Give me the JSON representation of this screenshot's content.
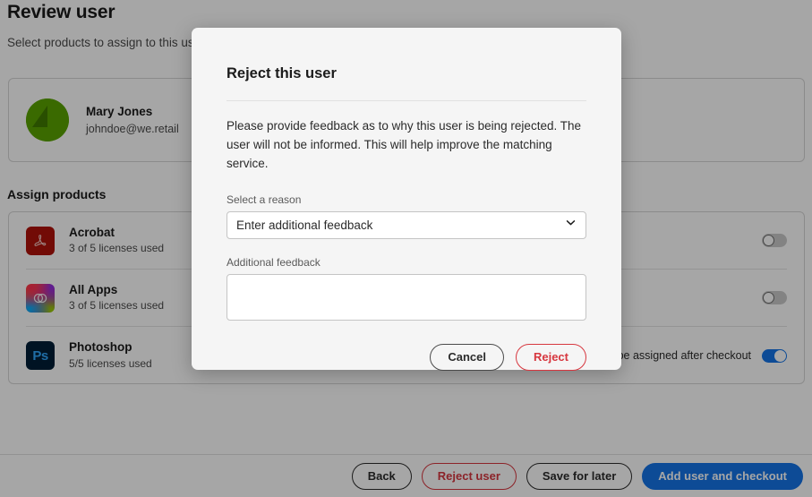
{
  "page": {
    "title": "Review user",
    "subtitle": "Select products to assign to this user",
    "section_title": "Assign products"
  },
  "user": {
    "name": "Mary Jones",
    "email": "johndoe@we.retail",
    "avatar_color": "#5aa300",
    "avatar_accent": "#3f7a00"
  },
  "products": [
    {
      "name": "Acrobat",
      "licenses": "3 of 5 licenses used",
      "icon": "acrobat-icon",
      "glyph": "A",
      "note": "",
      "toggle_on": false
    },
    {
      "name": "All Apps",
      "licenses": "3 of 5 licenses used",
      "icon": "creative-cloud-icon",
      "glyph": "",
      "note": "",
      "toggle_on": false
    },
    {
      "name": "Photoshop",
      "licenses": "5/5 licenses used",
      "icon": "photoshop-icon",
      "glyph": "Ps",
      "note": "ill be assigned after checkout",
      "toggle_on": true
    }
  ],
  "footer": {
    "back": "Back",
    "reject_user": "Reject user",
    "save_for_later": "Save for later",
    "add_user_and_checkout": "Add user and checkout"
  },
  "dialog": {
    "title": "Reject this user",
    "body": "Please provide feedback as to why this user is being rejected. The user will not be informed. This will help improve the matching service.",
    "reason_label": "Select a reason",
    "reason_value": "Enter additional feedback",
    "reason_options": [
      "Enter additional feedback"
    ],
    "feedback_label": "Additional feedback",
    "feedback_value": "",
    "feedback_placeholder": "",
    "cancel": "Cancel",
    "reject": "Reject"
  },
  "colors": {
    "primary_blue": "#1473e6",
    "danger_red": "#d7373f",
    "dialog_bg": "#f5f5f5",
    "page_bg": "#ffffff"
  }
}
